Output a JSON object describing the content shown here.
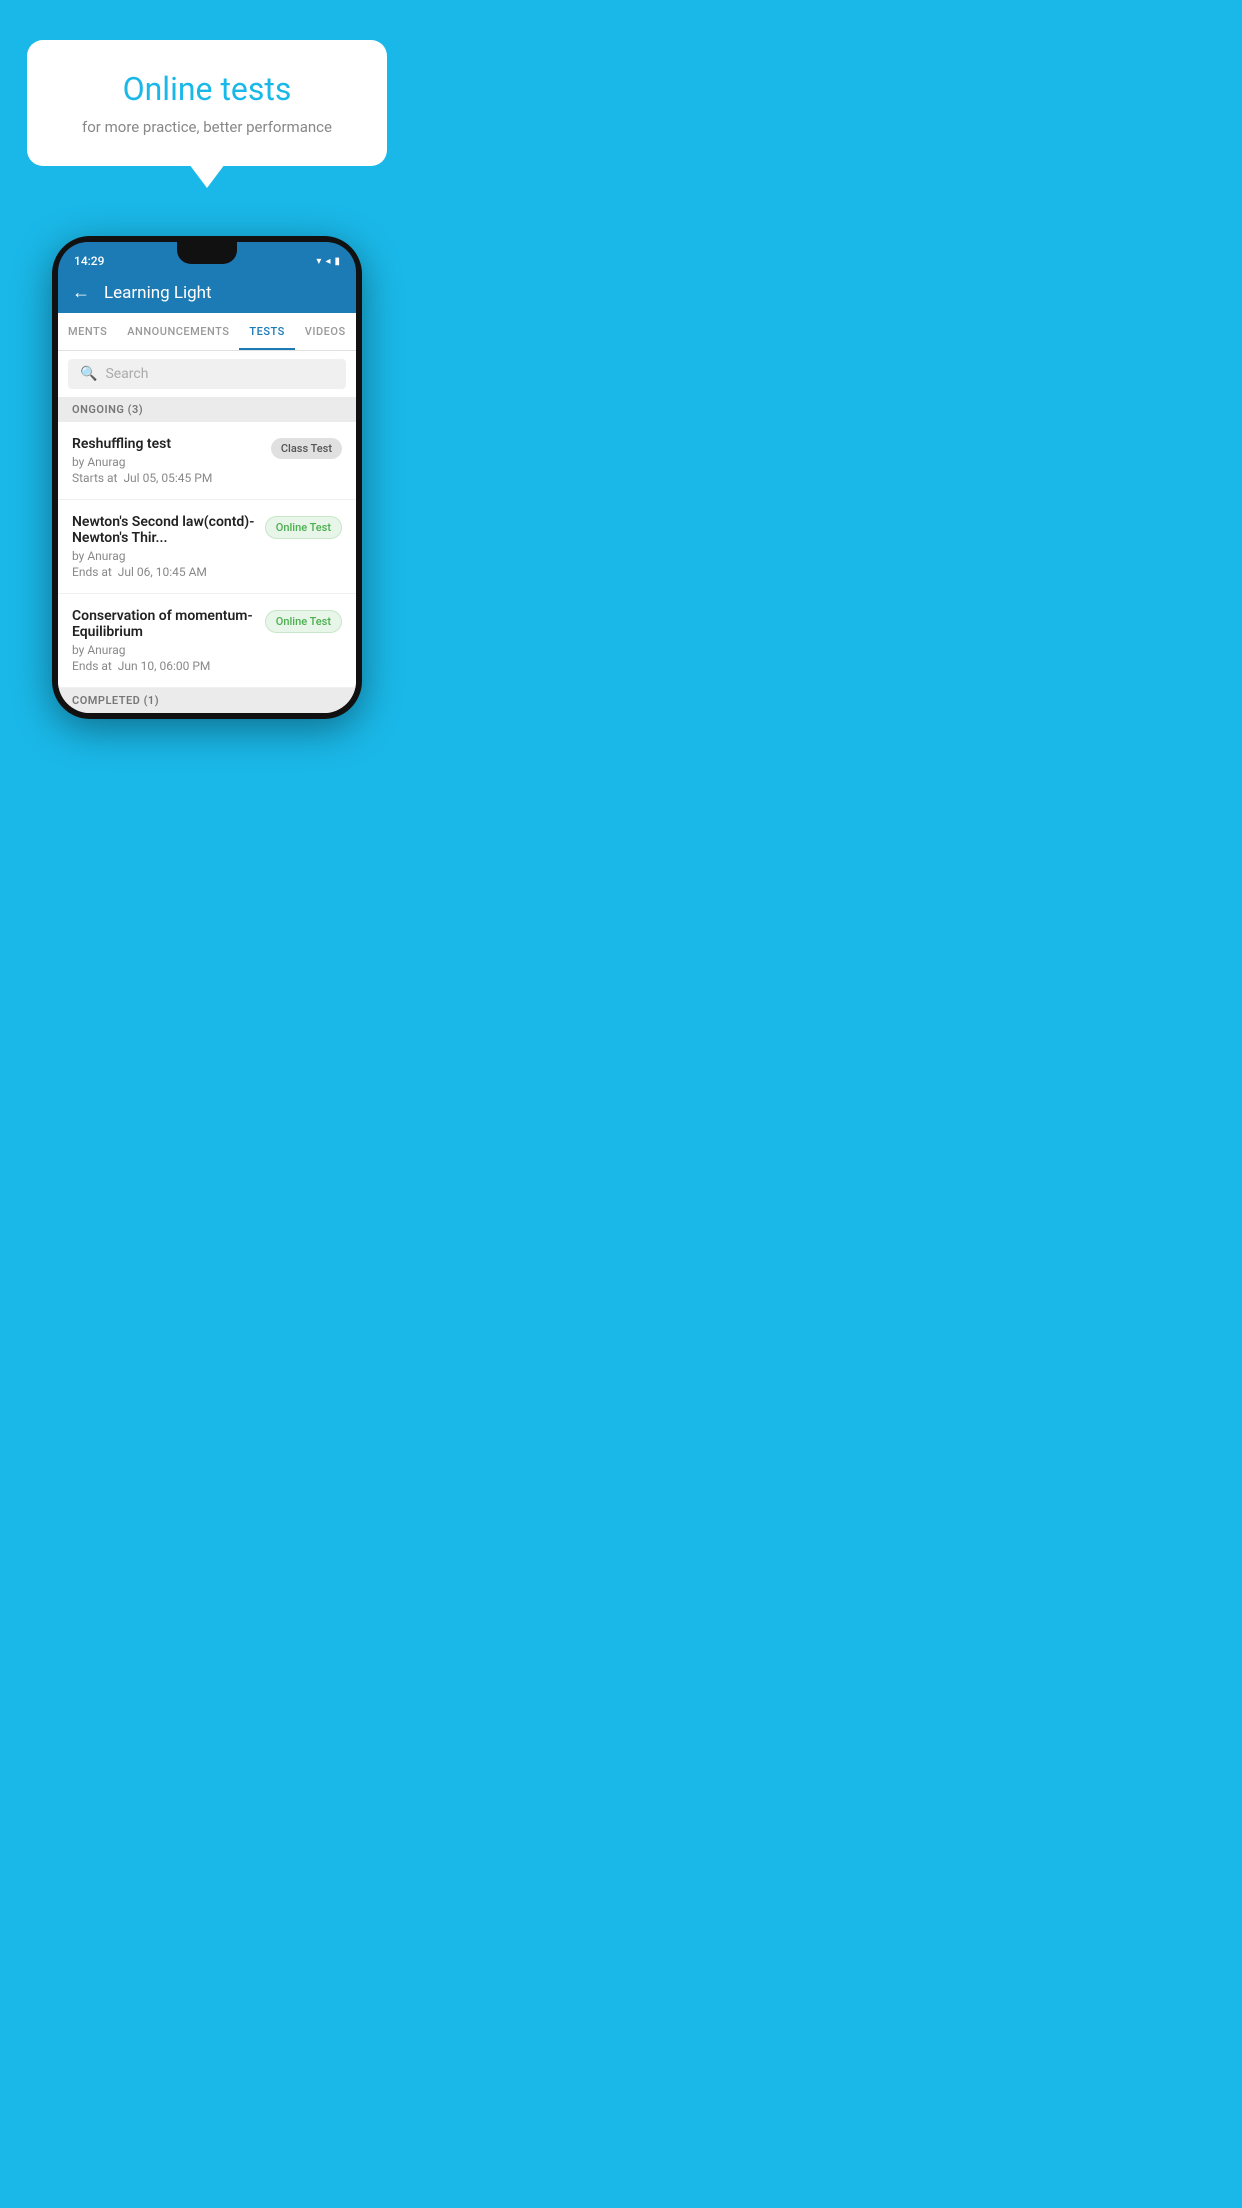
{
  "hero": {
    "title": "Online tests",
    "subtitle": "for more practice, better performance"
  },
  "phone": {
    "status_bar": {
      "time": "14:29",
      "wifi": "▼",
      "signal": "▲",
      "battery": "▌"
    },
    "app": {
      "title": "Learning Light",
      "back_label": "←"
    },
    "tabs": [
      {
        "label": "MENTS",
        "active": false
      },
      {
        "label": "ANNOUNCEMENTS",
        "active": false
      },
      {
        "label": "TESTS",
        "active": true
      },
      {
        "label": "VIDEOS",
        "active": false
      }
    ],
    "search": {
      "placeholder": "Search"
    },
    "ongoing": {
      "header": "ONGOING (3)",
      "items": [
        {
          "name": "Reshuffling test",
          "by": "by Anurag",
          "time": "Starts at  Jul 05, 05:45 PM",
          "badge": "Class Test",
          "badge_type": "class"
        },
        {
          "name": "Newton's Second law(contd)-Newton's Thir...",
          "by": "by Anurag",
          "time": "Ends at  Jul 06, 10:45 AM",
          "badge": "Online Test",
          "badge_type": "online"
        },
        {
          "name": "Conservation of momentum-Equilibrium",
          "by": "by Anurag",
          "time": "Ends at  Jun 10, 06:00 PM",
          "badge": "Online Test",
          "badge_type": "online"
        }
      ]
    },
    "completed": {
      "header": "COMPLETED (1)"
    }
  }
}
